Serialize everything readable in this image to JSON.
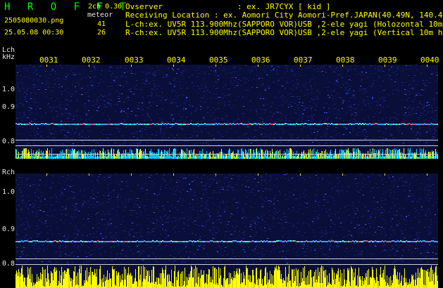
{
  "header": {
    "title": "H R O F F T",
    "filename": "2505080030.png",
    "datetime": "25.05.08 00:30",
    "mode": "2ch 0.30",
    "meteor_label": "meteor",
    "lch_count": "41",
    "rch_count": "26",
    "observer": "Ovserver                : ex. JR7CYX [ kid ]",
    "location": "Receiving Location : ex. Aomori City Aomori-Pref.JAPAN(40.49N, 140.47E)",
    "lch_info": "L-ch:ex. UV5R 113.900Mhz(SAPPORO VOR)USB ,2-ele yagi (Holozontal 10m height)",
    "rch_info": "R-ch:ex. UV5R 113.900Mhz(SAPPORO VOR)USB ,2-ele yagi (Vertical 10m height)"
  },
  "axis": {
    "lch_label": "Lch",
    "khz_label": "kHz",
    "rch_label": "Rch",
    "time_ticks": [
      "0031",
      "0032",
      "0033",
      "0034",
      "0035",
      "0036",
      "0037",
      "0038",
      "0039",
      "0040"
    ],
    "lch_freq_ticks": [
      "1.0",
      "0.9",
      "0.8"
    ],
    "rch_freq_ticks": [
      "1.0",
      "0.9",
      "0.8"
    ]
  },
  "colors": {
    "background": "#000000",
    "title": "#00ff00",
    "labels": "#ffff00",
    "text": "#e8e8e8",
    "spectrum_noise": "#1a2a8a",
    "signal_line": "#40c0ff",
    "histogram_lch": "#00c8ff",
    "histogram_rch": "#ffff00"
  }
}
